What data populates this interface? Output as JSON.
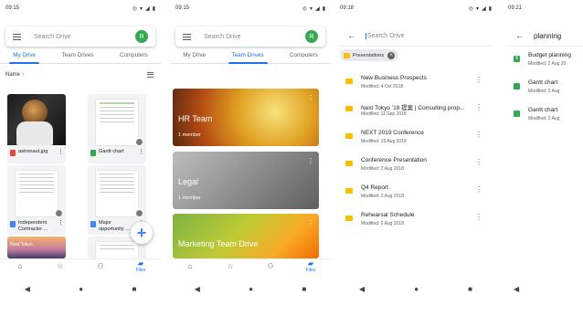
{
  "screens": [
    {
      "time": "09:15",
      "search_placeholder": "Search Drive",
      "avatar_letter": "R",
      "tabs": [
        "My Drive",
        "Team Drives",
        "Computers"
      ],
      "sort_label": "Name ↑",
      "files": [
        {
          "name": "astronaut.jpg",
          "kind": "image"
        },
        {
          "name": "Gantt chart",
          "kind": "sheet"
        },
        {
          "name": "Independent Contractor ...",
          "kind": "doc"
        },
        {
          "name": "Major opportunity ...",
          "kind": "doc"
        }
      ],
      "thumb_caption": "Next Tokyo",
      "fab_glyph": "+",
      "files_label": "Files"
    },
    {
      "time": "09:15",
      "search_placeholder": "Search Drive",
      "avatar_letter": "R",
      "tabs": [
        "My Drive",
        "Team Drives",
        "Computers"
      ],
      "team_drives": [
        {
          "name": "HR Team",
          "members": "1 member"
        },
        {
          "name": "Legal",
          "members": "1 member"
        },
        {
          "name": "Marketing Team Drive",
          "members": ""
        }
      ],
      "files_label": "Files"
    },
    {
      "time": "09:18",
      "search_placeholder": "Search Drive",
      "filter_chip": "Presentations",
      "results": [
        {
          "title": "New Business Prospects",
          "subtitle": "Modified: 4 Oct 2018"
        },
        {
          "title": "Next Tokyo '18 提案 | Consulting prop...",
          "subtitle": "Modified: 11 Sep 2018"
        },
        {
          "title": "NEXT 2019 Conference",
          "subtitle": "Modified: 15 Aug 2018"
        },
        {
          "title": "Conference Presentation",
          "subtitle": "Modified: 2 Aug 2018"
        },
        {
          "title": "Q4 Report",
          "subtitle": "Modified: 2 Aug 2018"
        },
        {
          "title": "Rehearsal Schedule",
          "subtitle": "Modified: 2 Aug 2018"
        }
      ]
    },
    {
      "time": "09:21",
      "query": "planning",
      "results": [
        {
          "title": "Budget planning",
          "subtitle": "Modified: 2 Aug 20"
        },
        {
          "title": "Gantt chart",
          "subtitle": "Modified: 2 Aug"
        },
        {
          "title": "Gantt chart",
          "subtitle": "Modified: 2 Aug"
        }
      ]
    }
  ],
  "system_nav": [
    "◀",
    "●",
    "■"
  ],
  "colors": {
    "accent": "#1a73e8",
    "avatar": "#34a853",
    "slides": "#fbbc04",
    "sheets": "#34a853",
    "docs": "#4285f4"
  }
}
